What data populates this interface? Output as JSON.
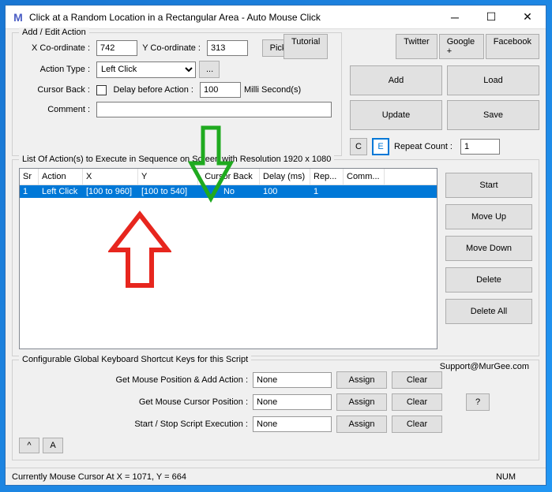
{
  "window": {
    "title": "Click at a Random Location in a Rectangular Area - Auto Mouse Click",
    "logo": "M"
  },
  "top_links": {
    "tutorial": "Tutorial",
    "twitter": "Twitter",
    "google": "Google +",
    "facebook": "Facebook"
  },
  "add_edit": {
    "legend": "Add / Edit Action",
    "x_label": "X Co-ordinate :",
    "x_value": "742",
    "y_label": "Y Co-ordinate :",
    "y_value": "313",
    "pick": "Pick",
    "action_type_label": "Action Type :",
    "action_type_value": "Left Click",
    "ellipsis": "...",
    "cursor_back_label": "Cursor Back :",
    "delay_label": "Delay before Action :",
    "delay_value": "100",
    "delay_unit": "Milli Second(s)",
    "comment_label": "Comment :",
    "comment_value": "",
    "c": "C",
    "e": "E",
    "repeat_label": "Repeat Count :",
    "repeat_value": "1"
  },
  "buttons": {
    "add": "Add",
    "load": "Load",
    "update": "Update",
    "save": "Save"
  },
  "list": {
    "legend": "List Of Action(s) to Execute in Sequence on Screen with Resolution 1920 x 1080",
    "headers": {
      "sr": "Sr",
      "action": "Action",
      "x": "X",
      "y": "Y",
      "cb": "Cursor Back",
      "delay": "Delay (ms)",
      "rep": "Rep...",
      "comm": "Comm..."
    },
    "rows": [
      {
        "sr": "1",
        "action": "Left Click",
        "x": "[100 to 960]",
        "y": "[100 to 540]",
        "cb": "No",
        "delay": "100",
        "rep": "1",
        "comm": ""
      }
    ]
  },
  "side": {
    "start": "Start",
    "moveup": "Move Up",
    "movedown": "Move Down",
    "delete": "Delete",
    "deleteall": "Delete All"
  },
  "shortcuts": {
    "legend": "Configurable Global Keyboard Shortcut Keys for this Script",
    "support": "Support@MurGee.com",
    "r1_label": "Get Mouse Position & Add Action :",
    "r2_label": "Get Mouse Cursor Position :",
    "r3_label": "Start / Stop Script Execution :",
    "none": "None",
    "assign": "Assign",
    "clear": "Clear",
    "help": "?"
  },
  "bottom": {
    "caret": "^",
    "a": "A"
  },
  "status": {
    "text": "Currently Mouse Cursor At X = 1071, Y = 664",
    "num": "NUM"
  }
}
